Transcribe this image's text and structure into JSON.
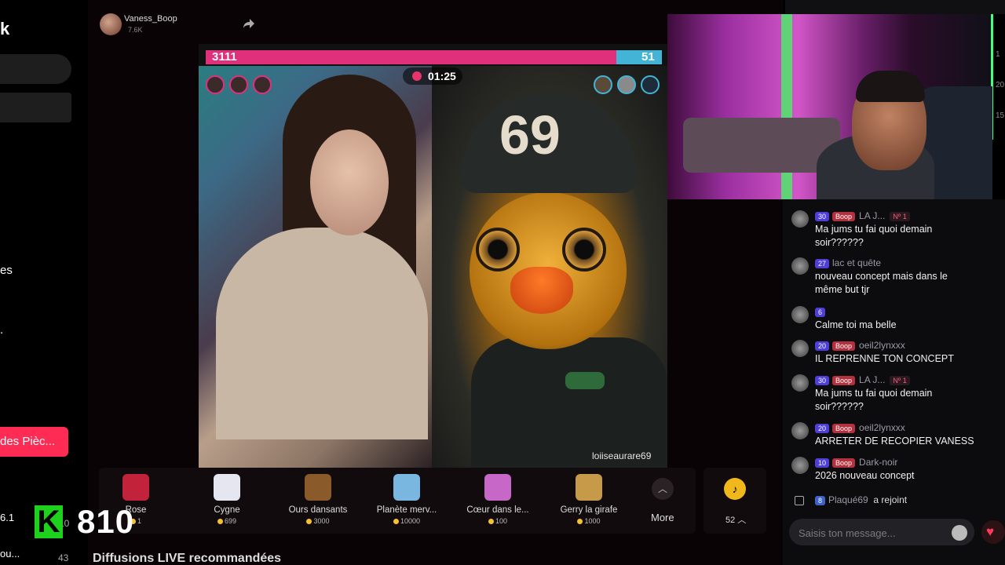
{
  "sidebar": {
    "brand_fragment": "k",
    "text_1": "es",
    "text_2": ".",
    "coins_button": "des Pièc...",
    "score_badge": "K",
    "score_value": "810",
    "sub_row_1_label": "6.1",
    "sub_row_1_value": "10",
    "sub_row_2_label": "ou...",
    "sub_row_2_value": "43"
  },
  "host": {
    "name": "Vaness_Boop",
    "likes": "7.6K"
  },
  "battle": {
    "score_left": "3111",
    "score_right": "51",
    "timer": "01:25",
    "guest_name": "loiiseaurare69",
    "cap_number": "69",
    "left_progress_fraction": 0.9
  },
  "gifts": [
    {
      "name": "Rose",
      "price": "1",
      "icon": "rose-icon",
      "color": "#c2233a"
    },
    {
      "name": "Cygne",
      "price": "699",
      "icon": "swan-icon",
      "color": "#e6e6f0"
    },
    {
      "name": "Ours dansants",
      "price": "3000",
      "icon": "bears-icon",
      "color": "#8a5a2a"
    },
    {
      "name": "Planète merv...",
      "price": "10000",
      "icon": "planet-icon",
      "color": "#79b6e0"
    },
    {
      "name": "Cœur dans le...",
      "price": "100",
      "icon": "heart-hands-icon",
      "color": "#c768c9"
    },
    {
      "name": "Gerry la girafe",
      "price": "1000",
      "icon": "giraffe-icon",
      "color": "#c79a4a"
    }
  ],
  "more_label": "More",
  "tiktok_count": "52",
  "recommended_title": "Diffusions LIVE recommandées",
  "chat": {
    "messages": [
      {
        "level": "30",
        "fan": "Boop",
        "user": "LA J...",
        "rank": "Nº 1",
        "text": "Ma jums tu fai quoi demain soir??????"
      },
      {
        "level": "27",
        "fan": "",
        "user": "lac et quête",
        "rank": "",
        "text": "nouveau concept mais dans le même but tjr"
      },
      {
        "level": "6",
        "fan": "",
        "user": "",
        "rank": "",
        "text": "Calme toi ma belle"
      },
      {
        "level": "20",
        "fan": "Boop",
        "user": "oeil2lynxxx",
        "rank": "",
        "text": "IL REPRENNE TON CONCEPT"
      },
      {
        "level": "30",
        "fan": "Boop",
        "user": "LA J...",
        "rank": "Nº 1",
        "text": "Ma jums tu fai quoi demain soir??????"
      },
      {
        "level": "20",
        "fan": "Boop",
        "user": "oeil2lynxxx",
        "rank": "",
        "text": "ARRETER DE RECOPIER VANESS"
      },
      {
        "level": "10",
        "fan": "Boop",
        "user": "Dark-noir",
        "rank": "",
        "text": "2026 nouveau concept"
      }
    ],
    "join": {
      "level": "8",
      "user": "Plaqué69",
      "text": "a rejoint"
    },
    "input_placeholder": "Saisis ton message..."
  },
  "right_edge_numbers": [
    "1",
    "20",
    "15"
  ],
  "colors": {
    "accent": "#fe2c55",
    "team_red": "#e0307c",
    "team_blue": "#44b4d6"
  }
}
